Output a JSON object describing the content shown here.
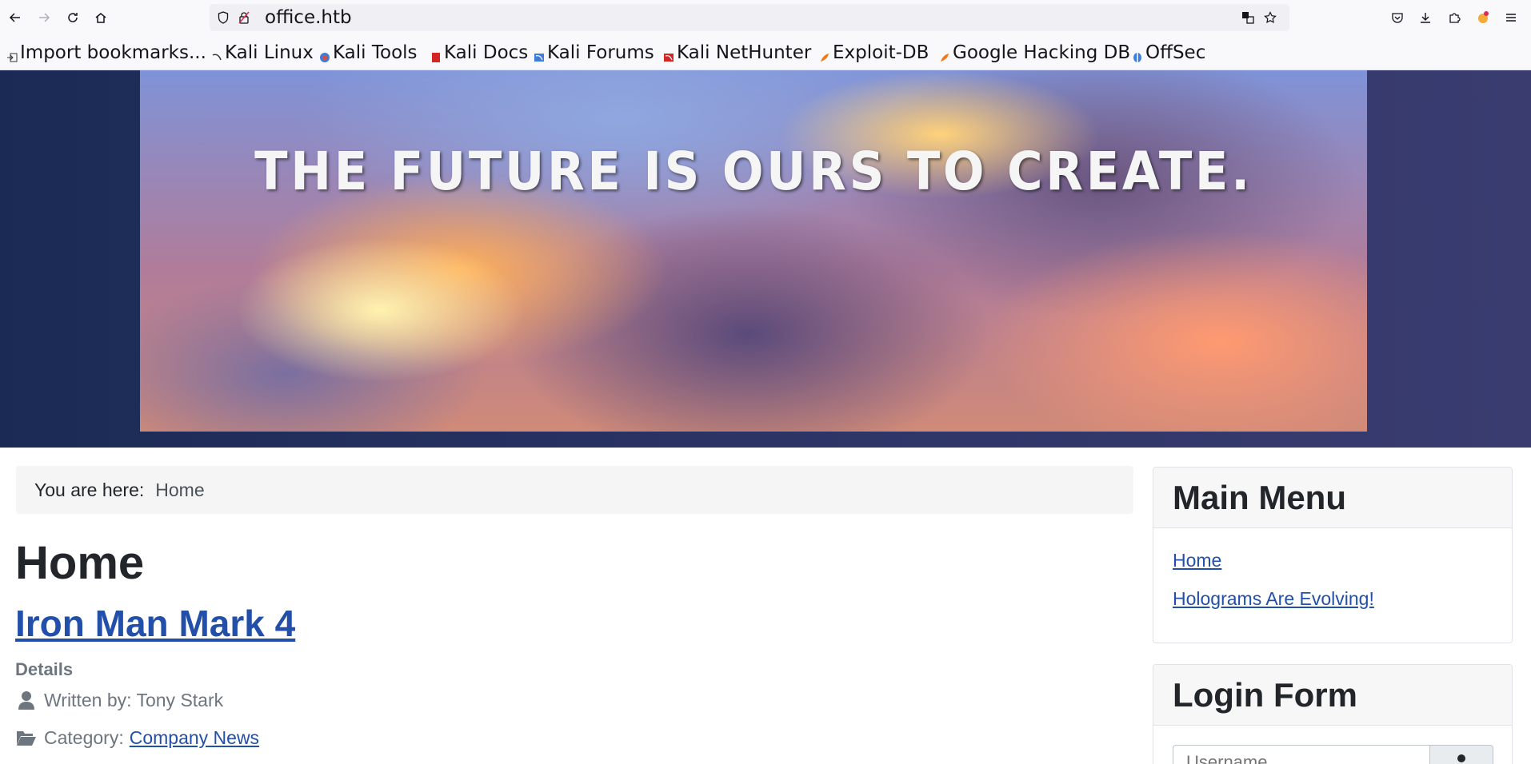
{
  "browser": {
    "url": "office.htb",
    "bookmarks": [
      {
        "label": "Import bookmarks...",
        "icon": "import-icon"
      },
      {
        "label": "Kali Linux",
        "icon": "kali-icon"
      },
      {
        "label": "Kali Tools",
        "icon": "kali-tools-icon"
      },
      {
        "label": "Kali Docs",
        "icon": "kali-docs-icon"
      },
      {
        "label": "Kali Forums",
        "icon": "kali-forums-icon"
      },
      {
        "label": "Kali NetHunter",
        "icon": "nethunter-icon"
      },
      {
        "label": "Exploit-DB",
        "icon": "exploit-db-icon"
      },
      {
        "label": "Google Hacking DB",
        "icon": "ghdb-icon"
      },
      {
        "label": "OffSec",
        "icon": "offsec-icon"
      }
    ]
  },
  "header": {
    "banner_text": "THE FUTURE IS OURS TO CREATE."
  },
  "breadcrumb": {
    "label": "You are here:",
    "current": "Home"
  },
  "main": {
    "page_title": "Home",
    "article": {
      "title": "Iron Man Mark 4",
      "details_label": "Details",
      "written_by": "Written by: Tony Stark",
      "category_label": "Category:",
      "category_value": "Company News"
    }
  },
  "sidebar": {
    "main_menu": {
      "title": "Main Menu",
      "items": [
        {
          "label": "Home",
          "active": true
        },
        {
          "label": "Holograms Are Evolving!",
          "active": false
        }
      ]
    },
    "login_form": {
      "title": "Login Form",
      "username_placeholder": "Username"
    }
  },
  "colors": {
    "link": "#224faa",
    "header_bg": "#1b2a55",
    "muted_text": "#6d757e"
  }
}
